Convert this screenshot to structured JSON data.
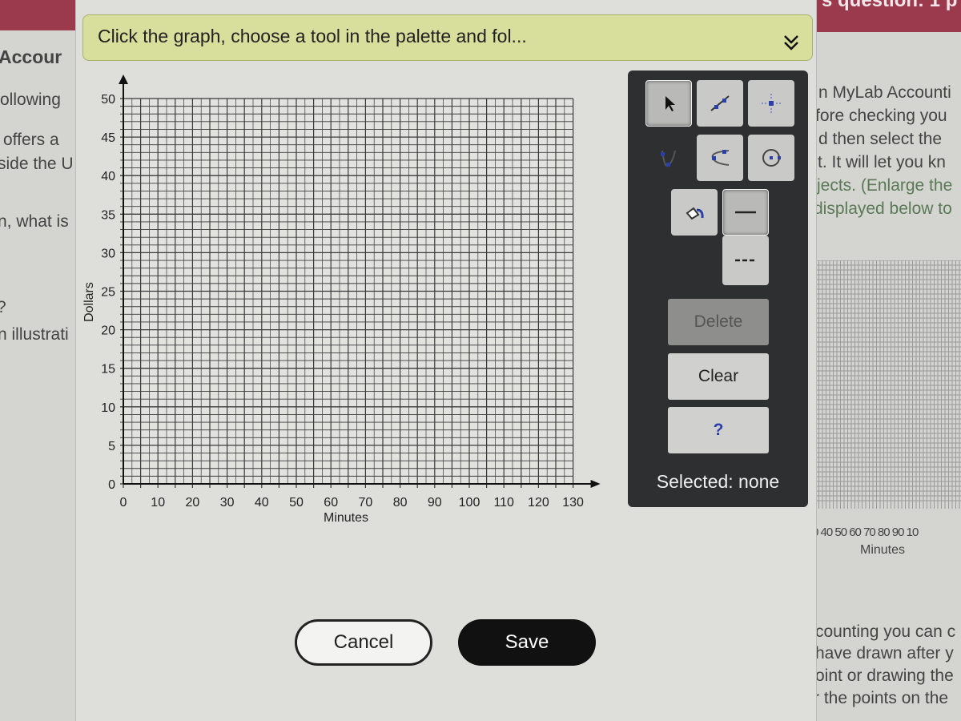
{
  "background_left": {
    "heading": "Accour",
    "lines": [
      "ollowing ",
      "offers a",
      "side the U",
      "n, what is",
      "?",
      "n illustrati"
    ]
  },
  "background_right": {
    "header": "s question: 1 p",
    "lines_top": [
      "n MyLab Accounti",
      "fore checking you",
      "d then select the",
      "t. It will let you kn"
    ],
    "lines_green": [
      "jects. (Enlarge the",
      "displayed below to"
    ],
    "mini_xticks": "0 40 50 60 70 80 90 10",
    "mini_xlabel": "Minutes",
    "lines_bottom": [
      "counting you can c",
      "have drawn after y",
      "oint or drawing the",
      "r the points on the"
    ]
  },
  "instruction": "Click the graph, choose a tool in the palette and fol...",
  "collapse_icon": "double-chevron-down",
  "graph": {
    "y_label": "Dollars",
    "x_label": "Minutes",
    "y_ticks": [
      "0",
      "5",
      "10",
      "15",
      "20",
      "25",
      "30",
      "35",
      "40",
      "45",
      "50"
    ],
    "x_ticks": [
      "0",
      "10",
      "20",
      "30",
      "40",
      "50",
      "60",
      "70",
      "80",
      "90",
      "100",
      "110",
      "120",
      "130"
    ],
    "xlim": [
      0,
      130
    ],
    "ylim": [
      0,
      50
    ],
    "grid": true
  },
  "palette": {
    "tools": [
      "pointer",
      "line",
      "point",
      "parabola-vertical",
      "parabola-horizontal",
      "circle",
      "fill",
      "solid-line",
      "dashed-line"
    ],
    "selected_tool": "pointer",
    "delete_label": "Delete",
    "clear_label": "Clear",
    "help_label": "?",
    "selected_text": "Selected: none"
  },
  "buttons": {
    "cancel": "Cancel",
    "save": "Save"
  },
  "colors": {
    "palette_bg": "#2d2f30",
    "instruction_bg": "#d8df9c",
    "accent_blue": "#2a3fa8",
    "header_red": "#9a3a4c"
  }
}
